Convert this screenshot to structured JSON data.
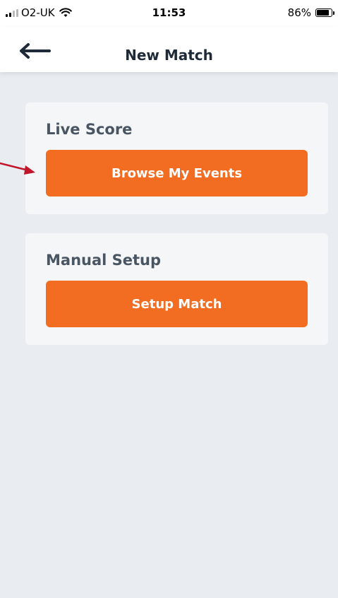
{
  "status_bar": {
    "carrier": "O2-UK",
    "time": "11:53",
    "battery_percent": "86%",
    "battery_level": 0.86
  },
  "nav": {
    "title": "New Match",
    "back_icon": "back-arrow-icon"
  },
  "sections": [
    {
      "title": "Live Score",
      "button_label": "Browse My Events"
    },
    {
      "title": "Manual Setup",
      "button_label": "Setup Match"
    }
  ],
  "colors": {
    "accent": "#f26d21",
    "background": "#e9edf1",
    "card": "#f4f6f8",
    "annotation_arrow": "#c0152a"
  }
}
